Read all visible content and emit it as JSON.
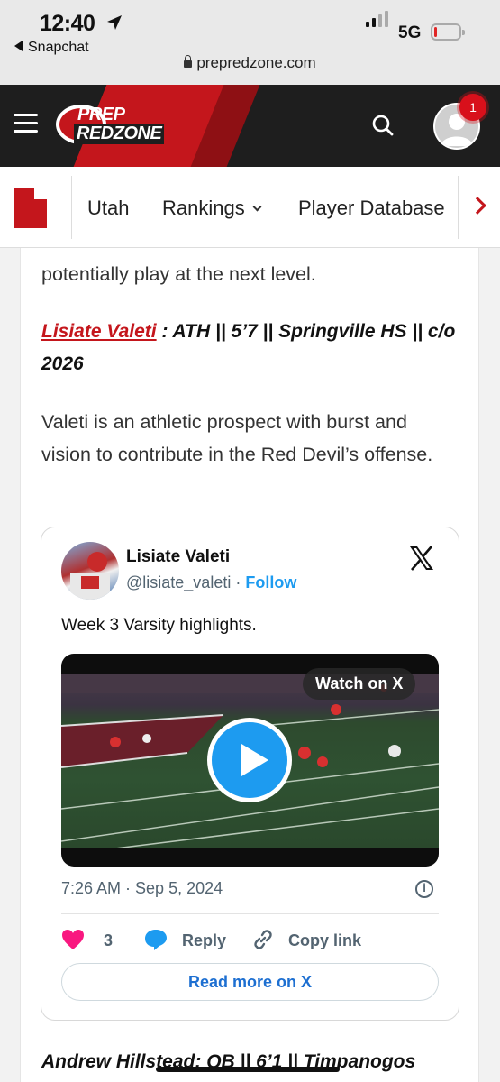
{
  "status_bar": {
    "time": "12:40",
    "back_app": "Snapchat",
    "network": "5G",
    "url": "prepredzone.com",
    "battery_level": 0.1,
    "battery_color": "#e02626"
  },
  "header": {
    "logo_line1": "PREP",
    "logo_line2": "REDZONE",
    "notification_count": "1",
    "brand_color": "#c4161c",
    "icons": [
      "menu-icon",
      "search-icon",
      "user-avatar-icon"
    ]
  },
  "nav": {
    "items": [
      {
        "label": "Utah"
      },
      {
        "label": "Rankings"
      },
      {
        "label": "Player Database"
      }
    ],
    "icons": [
      "utah-flag-icon",
      "chevron-right-icon"
    ]
  },
  "article": {
    "intro_text": "potentially play at the next level.",
    "player": {
      "name": "Lisiate Valeti",
      "details": " : ATH || 5’7 || Springville HS || c/o 2026"
    },
    "description": "Valeti is an athletic prospect with burst and vision to contribute in the Red Devil’s offense.",
    "next_player": "Andrew Hillstead: QB || 6’1 || Timpanogos"
  },
  "tweet": {
    "name": "Lisiate Valeti",
    "handle": "@lisiate_valeti",
    "separator": "·",
    "follow": "Follow",
    "text": "Week 3 Varsity highlights.",
    "watch_label": "Watch on X",
    "timestamp": "7:26 AM · Sep 5, 2024",
    "likes": "3",
    "reply": "Reply",
    "copy_link": "Copy link",
    "read_more": "Read more on X",
    "accent_color": "#1d9bf0",
    "like_color": "#f91880"
  }
}
